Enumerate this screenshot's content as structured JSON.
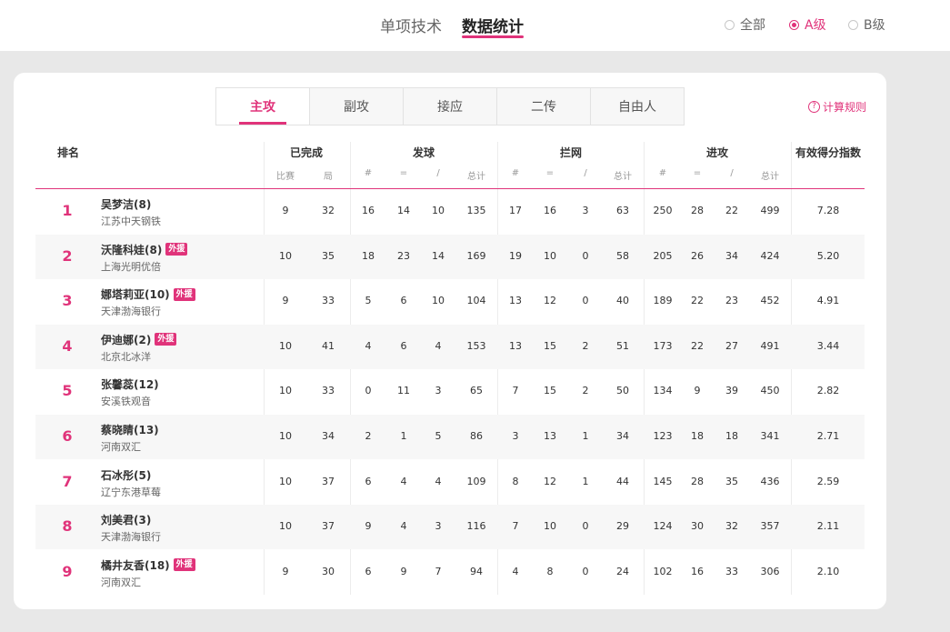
{
  "top_tabs": [
    {
      "label": "单项技术",
      "active": false
    },
    {
      "label": "数据统计",
      "active": true
    }
  ],
  "level_filter": [
    {
      "label": "全部",
      "selected": false
    },
    {
      "label": "A级",
      "selected": true
    },
    {
      "label": "B级",
      "selected": false
    }
  ],
  "position_tabs": [
    {
      "label": "主攻",
      "active": true
    },
    {
      "label": "副攻",
      "active": false
    },
    {
      "label": "接应",
      "active": false
    },
    {
      "label": "二传",
      "active": false
    },
    {
      "label": "自由人",
      "active": false
    }
  ],
  "calc_rules": {
    "icon": "question-circle-icon",
    "label": "计算规则"
  },
  "accent_color": "#e0337a",
  "table": {
    "headers": {
      "rank": "排名",
      "completed": "已完成",
      "serve": "发球",
      "block": "拦网",
      "attack": "进攻",
      "index": "有效得分指数"
    },
    "sub_headers": {
      "completed": [
        "比赛",
        "局"
      ],
      "serve": [
        "#",
        "=",
        "/",
        "总计"
      ],
      "block": [
        "#",
        "=",
        "/",
        "总计"
      ],
      "attack": [
        "#",
        "=",
        "/",
        "总计"
      ]
    },
    "foreign_label": "外援",
    "rows": [
      {
        "rank": "1",
        "name": "吴梦洁(8)",
        "foreign": false,
        "team": "江苏中天钢铁",
        "matches": "9",
        "sets": "32",
        "serve": [
          "16",
          "14",
          "10",
          "135"
        ],
        "block": [
          "17",
          "16",
          "3",
          "63"
        ],
        "attack": [
          "250",
          "28",
          "22",
          "499"
        ],
        "index": "7.28"
      },
      {
        "rank": "2",
        "name": "沃隆科娃(8)",
        "foreign": true,
        "team": "上海光明优倍",
        "matches": "10",
        "sets": "35",
        "serve": [
          "18",
          "23",
          "14",
          "169"
        ],
        "block": [
          "19",
          "10",
          "0",
          "58"
        ],
        "attack": [
          "205",
          "26",
          "34",
          "424"
        ],
        "index": "5.20"
      },
      {
        "rank": "3",
        "name": "娜塔莉亚(10)",
        "foreign": true,
        "team": "天津渤海银行",
        "matches": "9",
        "sets": "33",
        "serve": [
          "5",
          "6",
          "10",
          "104"
        ],
        "block": [
          "13",
          "12",
          "0",
          "40"
        ],
        "attack": [
          "189",
          "22",
          "23",
          "452"
        ],
        "index": "4.91"
      },
      {
        "rank": "4",
        "name": "伊迪娜(2)",
        "foreign": true,
        "team": "北京北冰洋",
        "matches": "10",
        "sets": "41",
        "serve": [
          "4",
          "6",
          "4",
          "153"
        ],
        "block": [
          "13",
          "15",
          "2",
          "51"
        ],
        "attack": [
          "173",
          "22",
          "27",
          "491"
        ],
        "index": "3.44"
      },
      {
        "rank": "5",
        "name": "张馨蕊(12)",
        "foreign": false,
        "team": "安溪铁观音",
        "matches": "10",
        "sets": "33",
        "serve": [
          "0",
          "11",
          "3",
          "65"
        ],
        "block": [
          "7",
          "15",
          "2",
          "50"
        ],
        "attack": [
          "134",
          "9",
          "39",
          "450"
        ],
        "index": "2.82"
      },
      {
        "rank": "6",
        "name": "蔡晓睛(13)",
        "foreign": false,
        "team": "河南双汇",
        "matches": "10",
        "sets": "34",
        "serve": [
          "2",
          "1",
          "5",
          "86"
        ],
        "block": [
          "3",
          "13",
          "1",
          "34"
        ],
        "attack": [
          "123",
          "18",
          "18",
          "341"
        ],
        "index": "2.71"
      },
      {
        "rank": "7",
        "name": "石冰彤(5)",
        "foreign": false,
        "team": "辽宁东港草莓",
        "matches": "10",
        "sets": "37",
        "serve": [
          "6",
          "4",
          "4",
          "109"
        ],
        "block": [
          "8",
          "12",
          "1",
          "44"
        ],
        "attack": [
          "145",
          "28",
          "35",
          "436"
        ],
        "index": "2.59"
      },
      {
        "rank": "8",
        "name": "刘美君(3)",
        "foreign": false,
        "team": "天津渤海银行",
        "matches": "10",
        "sets": "37",
        "serve": [
          "9",
          "4",
          "3",
          "116"
        ],
        "block": [
          "7",
          "10",
          "0",
          "29"
        ],
        "attack": [
          "124",
          "30",
          "32",
          "357"
        ],
        "index": "2.11"
      },
      {
        "rank": "9",
        "name": "橘井友香(18)",
        "foreign": true,
        "team": "河南双汇",
        "matches": "9",
        "sets": "30",
        "serve": [
          "6",
          "9",
          "7",
          "94"
        ],
        "block": [
          "4",
          "8",
          "0",
          "24"
        ],
        "attack": [
          "102",
          "16",
          "33",
          "306"
        ],
        "index": "2.10"
      }
    ]
  }
}
